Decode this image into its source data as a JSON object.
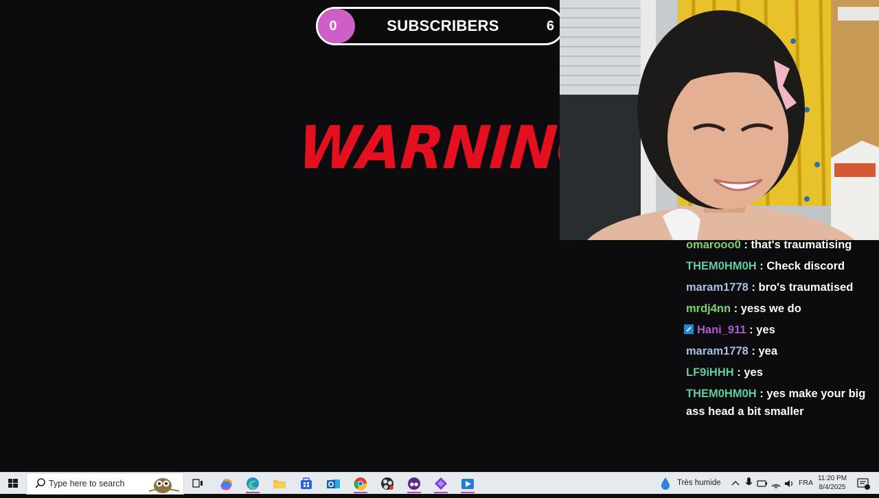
{
  "subscriber_goal": {
    "current": "0",
    "label": "SUBSCRIBERS",
    "target": "6",
    "progress_fraction": 0.0,
    "fill_color": "#cf5fc8"
  },
  "warning": {
    "text": "WARNING",
    "color": "#e4101f"
  },
  "chat": [
    {
      "user": "omarooo0",
      "user_color": "#7cd36d",
      "message": "that's traumatising",
      "badge": ""
    },
    {
      "user": "THEM0HM0H",
      "user_color": "#5ecfa1",
      "message": "Check discord",
      "badge": ""
    },
    {
      "user": "maram1778",
      "user_color": "#a9c2e8",
      "message": "bro's traumatised",
      "badge": ""
    },
    {
      "user": "mrdj4nn",
      "user_color": "#7dd66a",
      "message": "yess we do",
      "badge": ""
    },
    {
      "user": "Hani_911",
      "user_color": "#b05bd9",
      "message": "yes",
      "badge": "boost-badge-icon"
    },
    {
      "user": "maram1778",
      "user_color": "#a9c2e8",
      "message": "yea",
      "badge": ""
    },
    {
      "user": "LF9iHHH",
      "user_color": "#5ecfa1",
      "message": "yes",
      "badge": ""
    },
    {
      "user": "THEM0HM0H",
      "user_color": "#5ecfa1",
      "message": "yes make your big ass head a bit smaller",
      "badge": ""
    }
  ],
  "taskbar": {
    "search_placeholder": "Type here to search",
    "weather_text": "Très humide",
    "language": "FRA",
    "time": "11:20 PM",
    "date": "8/4/2025",
    "apps": [
      "task-view-icon",
      "copilot-icon",
      "edge-icon",
      "file-explorer-icon",
      "store-icon",
      "outlook-icon",
      "chrome-icon",
      "obs-icon",
      "twitch-tool-icon",
      "streamlabs-icon",
      "media-player-icon"
    ]
  }
}
